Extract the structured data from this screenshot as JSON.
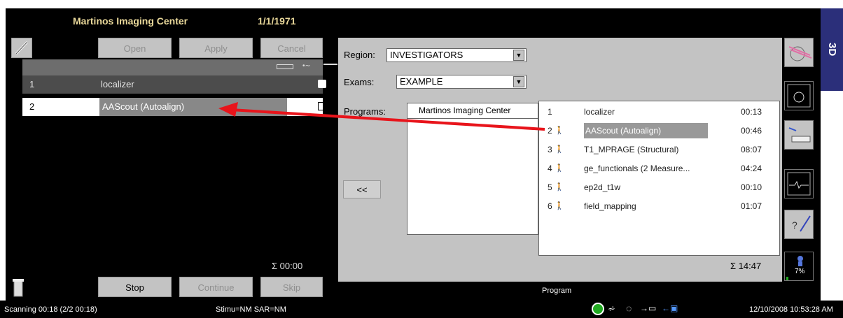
{
  "header": {
    "site": "Martinos Imaging Center",
    "date": "1/1/1971",
    "threed": "3D"
  },
  "buttons": {
    "open": "Open",
    "apply": "Apply",
    "cancel": "Cancel",
    "stop": "Stop",
    "continue": "Continue",
    "skip": "Skip",
    "move_left": "<<"
  },
  "queue": {
    "rows": [
      {
        "num": "1",
        "name": "localizer"
      },
      {
        "num": "2",
        "name": "AAScout (Autoalign)"
      }
    ],
    "total": "Σ 00:00"
  },
  "form": {
    "region_label": "Region:",
    "region_value": "INVESTIGATORS",
    "exams_label": "Exams:",
    "exams_value": "EXAMPLE",
    "programs_label": "Programs:",
    "program_selected": "Martinos Imaging Center"
  },
  "programs": [
    {
      "num": "1",
      "name": "localizer",
      "time": "00:13"
    },
    {
      "num": "2",
      "name": "AAScout (Autoalign)",
      "time": "00:46"
    },
    {
      "num": "3",
      "name": "T1_MPRAGE (Structural)",
      "time": "08:07"
    },
    {
      "num": "4",
      "name": "ge_functionals (2 Measure...",
      "time": "04:24"
    },
    {
      "num": "5",
      "name": "ep2d_t1w",
      "time": "00:10"
    },
    {
      "num": "6",
      "name": "field_mapping",
      "time": "01:07"
    }
  ],
  "programs_total": "Σ 14:47",
  "program_footer": "Program",
  "sar_percent": "7%",
  "status": {
    "scanning": "Scanning 00:18 (2/2 00:18)",
    "stim": "Stimu=NM SAR=NM",
    "datetime": "12/10/2008 10:53:28 AM"
  },
  "colors": {
    "arrow": "#e8141b",
    "header_text": "#e9d89a",
    "panel_gray": "#c3c3c3"
  }
}
